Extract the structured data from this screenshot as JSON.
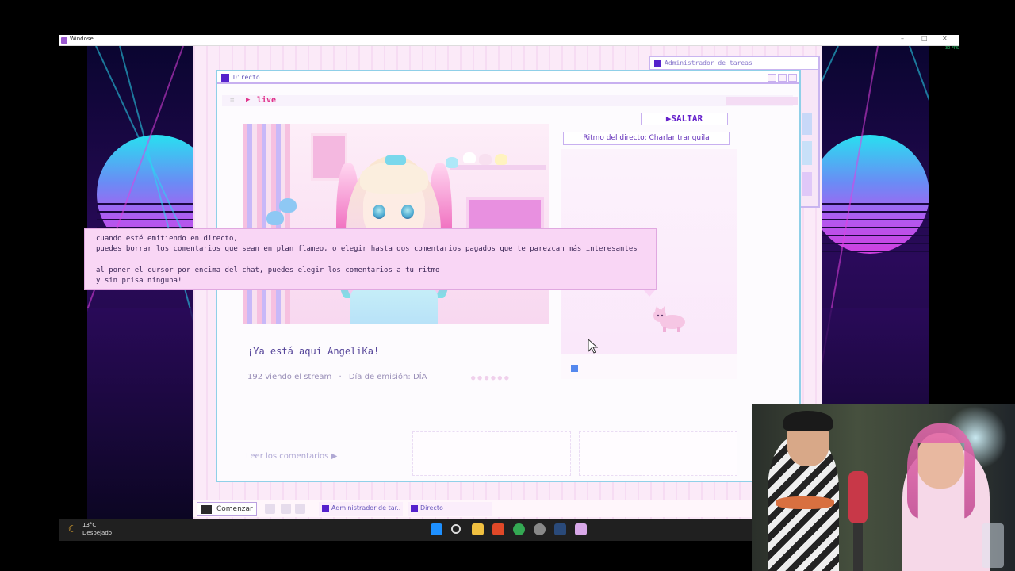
{
  "host": {
    "title": "Windose",
    "fps": "30 FPS"
  },
  "taskmgr": {
    "title": "Administrador de tareas"
  },
  "window": {
    "title": "Directo"
  },
  "live": {
    "label": "live"
  },
  "stream": {
    "title": "¡Ya está aquí AngeliKa!",
    "viewers": "192 viendo el stream",
    "separator": "·",
    "day": "Día de emisión: DÍA"
  },
  "controls": {
    "skip_label": "▶SALTAR",
    "rhythm_label": "Ritmo del directo: Charlar tranquila"
  },
  "read_comments": "Leer los comentarios ▶",
  "dialog": {
    "line1": "cuando esté emitiendo en directo,",
    "line2": "puedes borrar los comentarios que sean en plan flameo, o elegir hasta dos comentarios pagados que te parezcan más interesantes",
    "line3": "al poner el cursor por encima del chat, puedes elegir los comentarios a tu ritmo",
    "line4": "y sin prisa ninguna!"
  },
  "game_taskbar": {
    "start_label": "Comenzar",
    "tasks": [
      "Administrador de tar...",
      "Directo"
    ]
  },
  "os_taskbar": {
    "weather_temp": "13°C",
    "weather_condition": "Despejado",
    "apps": [
      "start-icon",
      "search-icon",
      "files-icon",
      "brave-icon",
      "chrome-icon",
      "obs-icon",
      "steam-icon",
      "game-icon"
    ]
  },
  "colors": {
    "accent": "#5522cc",
    "live": "#e0308a",
    "dialog_bg": "#f9d6f5"
  }
}
